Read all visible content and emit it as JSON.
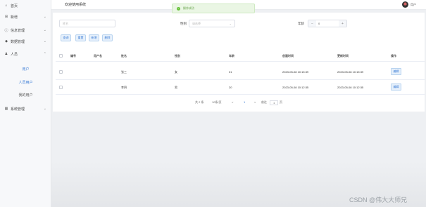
{
  "sidebar": {
    "items": [
      {
        "label": "首页",
        "icon": "home-icon"
      },
      {
        "label": "新增",
        "icon": "plus-icon"
      },
      {
        "label": "信息管理",
        "icon": "info-icon"
      },
      {
        "label": "数据管理",
        "icon": "pin-icon"
      },
      {
        "label": "人员",
        "icon": "user-icon"
      },
      {
        "label": "系统管理",
        "icon": "grid-icon"
      }
    ],
    "subitems": [
      "用户",
      "人员用户",
      "我的用户"
    ]
  },
  "header": {
    "title": "欢迎使用系统",
    "username": "用户"
  },
  "toast": {
    "text": "操作成功"
  },
  "filters": {
    "name_placeholder": "姓名",
    "gender_label": "性别",
    "gender_placeholder": "请选择",
    "age_label": "年龄",
    "age_value": "0",
    "minus": "−",
    "plus": "+"
  },
  "toolbar": {
    "buttons": [
      "查询",
      "重置",
      "新增",
      "删除"
    ]
  },
  "table": {
    "headers": [
      "编号",
      "用户名",
      "姓名",
      "性别",
      "年龄",
      "创建时间",
      "更新时间",
      "操作"
    ],
    "rows": [
      {
        "name": "张三",
        "gender": "女",
        "age": "31",
        "created": "2023-05-08 10:15:39",
        "updated": "2023-05-08 10:15:39",
        "action": "编辑"
      },
      {
        "name": "李四",
        "gender": "男",
        "age": "20",
        "created": "2023-05-08 10:12:35",
        "updated": "2023-05-08 10:12:35",
        "action": "编辑"
      }
    ]
  },
  "pagination": {
    "total": "共 2 条",
    "page_size": "10条/页",
    "prev": "<",
    "page": "1",
    "next": ">",
    "goto": "前往",
    "goto_value": "1",
    "page_unit": "页"
  },
  "watermark": "CSDN @伟大大师兄",
  "colors": {
    "accent": "#3a7bd5",
    "success": "#67c23a"
  }
}
